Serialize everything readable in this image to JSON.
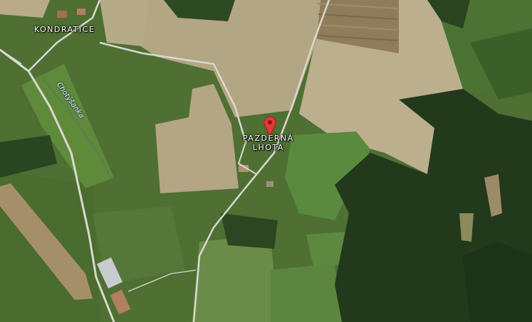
{
  "map": {
    "view": "satellite",
    "places": {
      "kondratice": "KONDRATICE",
      "pazderna_line1": "PAZDERNÁ",
      "pazderna_line2": "LHOTA"
    },
    "waterways": {
      "stream": "Chotýšanka"
    },
    "marker": {
      "icon": "map-pin-icon",
      "color": "#e53935"
    },
    "colors": {
      "field_light": "#b9ab8a",
      "field_mid": "#a89b78",
      "meadow": "#5e7f3b",
      "forest": "#213a1c",
      "road": "#d8d8d0"
    }
  }
}
